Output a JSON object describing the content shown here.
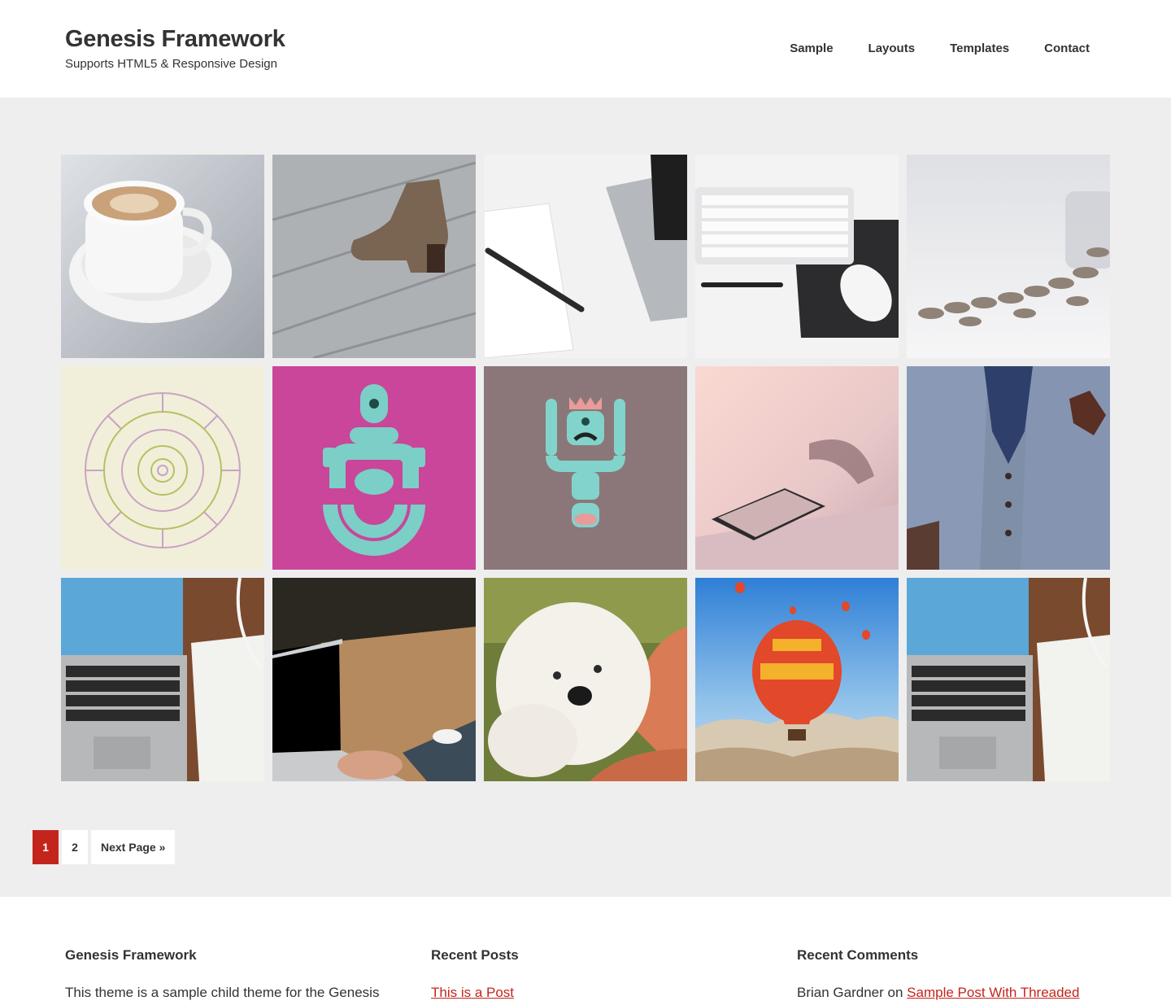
{
  "header": {
    "site_title": "Genesis Framework",
    "site_description": "Supports HTML5 & Responsive Design",
    "nav": [
      "Sample",
      "Layouts",
      "Templates",
      "Contact"
    ]
  },
  "grid": {
    "tiles": [
      {
        "name": "coffee-cup-image"
      },
      {
        "name": "boot-image"
      },
      {
        "name": "tablet-pen-image"
      },
      {
        "name": "keyboard-mouse-image"
      },
      {
        "name": "coins-jar-image"
      },
      {
        "name": "mandala-illustration"
      },
      {
        "name": "magenta-creature-illustration"
      },
      {
        "name": "king-creature-illustration"
      },
      {
        "name": "phone-glasses-image"
      },
      {
        "name": "tweed-jacket-image"
      },
      {
        "name": "laptop-desk-image"
      },
      {
        "name": "typing-laptop-image"
      },
      {
        "name": "puppy-image"
      },
      {
        "name": "hot-air-balloon-image"
      },
      {
        "name": "laptop-desk-image-2"
      }
    ]
  },
  "pagination": {
    "pages": [
      "1",
      "2"
    ],
    "next": "Next Page »",
    "active_color": "#c3251d"
  },
  "footer": {
    "widget1": {
      "title": "Genesis Framework",
      "text": "This theme is a sample child theme for the Genesis"
    },
    "widget2": {
      "title": "Recent Posts",
      "link": "This is a Post"
    },
    "widget3": {
      "title": "Recent Comments",
      "author": "Brian Gardner",
      "on": "on",
      "link": "Sample Post With Threaded"
    }
  }
}
